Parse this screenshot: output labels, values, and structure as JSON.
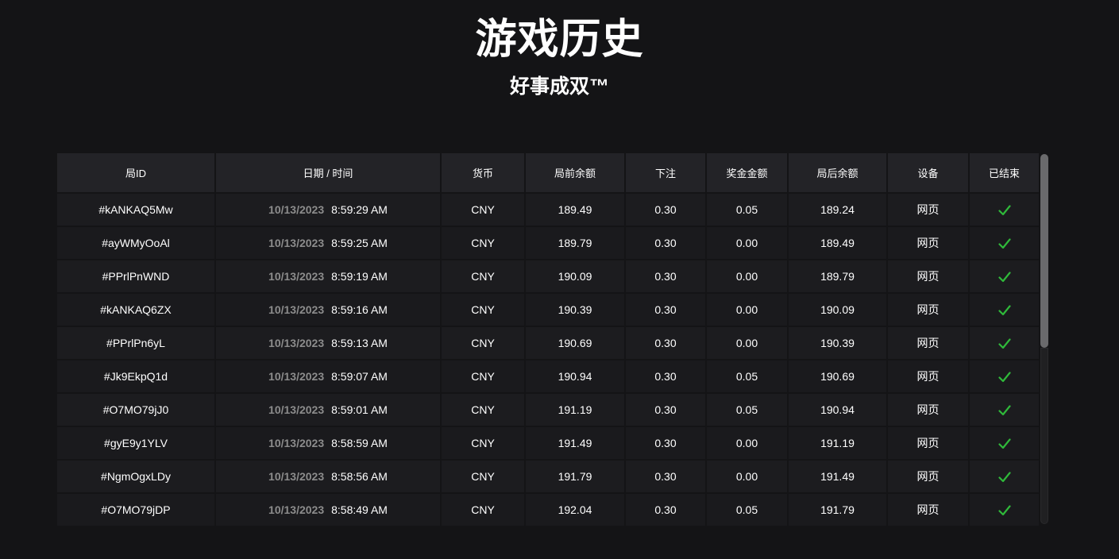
{
  "header": {
    "title": "游戏历史",
    "subtitle": "好事成双™"
  },
  "table": {
    "columns": [
      "局ID",
      "日期 / 时间",
      "货币",
      "局前余额",
      "下注",
      "奖金金额",
      "局后余额",
      "设备",
      "已结束"
    ],
    "rows": [
      {
        "id": "#kANKAQ5Mw",
        "date": "10/13/2023",
        "time": "8:59:29 AM",
        "currency": "CNY",
        "before": "189.49",
        "bet": "0.30",
        "win": "0.05",
        "after": "189.24",
        "device": "网页",
        "ended": "check-icon"
      },
      {
        "id": "#ayWMyOoAl",
        "date": "10/13/2023",
        "time": "8:59:25 AM",
        "currency": "CNY",
        "before": "189.79",
        "bet": "0.30",
        "win": "0.00",
        "after": "189.49",
        "device": "网页",
        "ended": "check-icon"
      },
      {
        "id": "#PPrlPnWND",
        "date": "10/13/2023",
        "time": "8:59:19 AM",
        "currency": "CNY",
        "before": "190.09",
        "bet": "0.30",
        "win": "0.00",
        "after": "189.79",
        "device": "网页",
        "ended": "check-icon"
      },
      {
        "id": "#kANKAQ6ZX",
        "date": "10/13/2023",
        "time": "8:59:16 AM",
        "currency": "CNY",
        "before": "190.39",
        "bet": "0.30",
        "win": "0.00",
        "after": "190.09",
        "device": "网页",
        "ended": "check-icon"
      },
      {
        "id": "#PPrlPn6yL",
        "date": "10/13/2023",
        "time": "8:59:13 AM",
        "currency": "CNY",
        "before": "190.69",
        "bet": "0.30",
        "win": "0.00",
        "after": "190.39",
        "device": "网页",
        "ended": "check-icon"
      },
      {
        "id": "#Jk9EkpQ1d",
        "date": "10/13/2023",
        "time": "8:59:07 AM",
        "currency": "CNY",
        "before": "190.94",
        "bet": "0.30",
        "win": "0.05",
        "after": "190.69",
        "device": "网页",
        "ended": "check-icon"
      },
      {
        "id": "#O7MO79jJ0",
        "date": "10/13/2023",
        "time": "8:59:01 AM",
        "currency": "CNY",
        "before": "191.19",
        "bet": "0.30",
        "win": "0.05",
        "after": "190.94",
        "device": "网页",
        "ended": "check-icon"
      },
      {
        "id": "#gyE9y1YLV",
        "date": "10/13/2023",
        "time": "8:58:59 AM",
        "currency": "CNY",
        "before": "191.49",
        "bet": "0.30",
        "win": "0.00",
        "after": "191.19",
        "device": "网页",
        "ended": "check-icon"
      },
      {
        "id": "#NgmOgxLDy",
        "date": "10/13/2023",
        "time": "8:58:56 AM",
        "currency": "CNY",
        "before": "191.79",
        "bet": "0.30",
        "win": "0.00",
        "after": "191.49",
        "device": "网页",
        "ended": "check-icon"
      },
      {
        "id": "#O7MO79jDP",
        "date": "10/13/2023",
        "time": "8:58:49 AM",
        "currency": "CNY",
        "before": "192.04",
        "bet": "0.30",
        "win": "0.05",
        "after": "191.79",
        "device": "网页",
        "ended": "check-icon"
      }
    ]
  },
  "colors": {
    "background": "#141416",
    "header_bg": "#232327",
    "row_bg": "#1c1c1f",
    "date_text": "#8c8c8c",
    "check": "#2fb93a"
  }
}
